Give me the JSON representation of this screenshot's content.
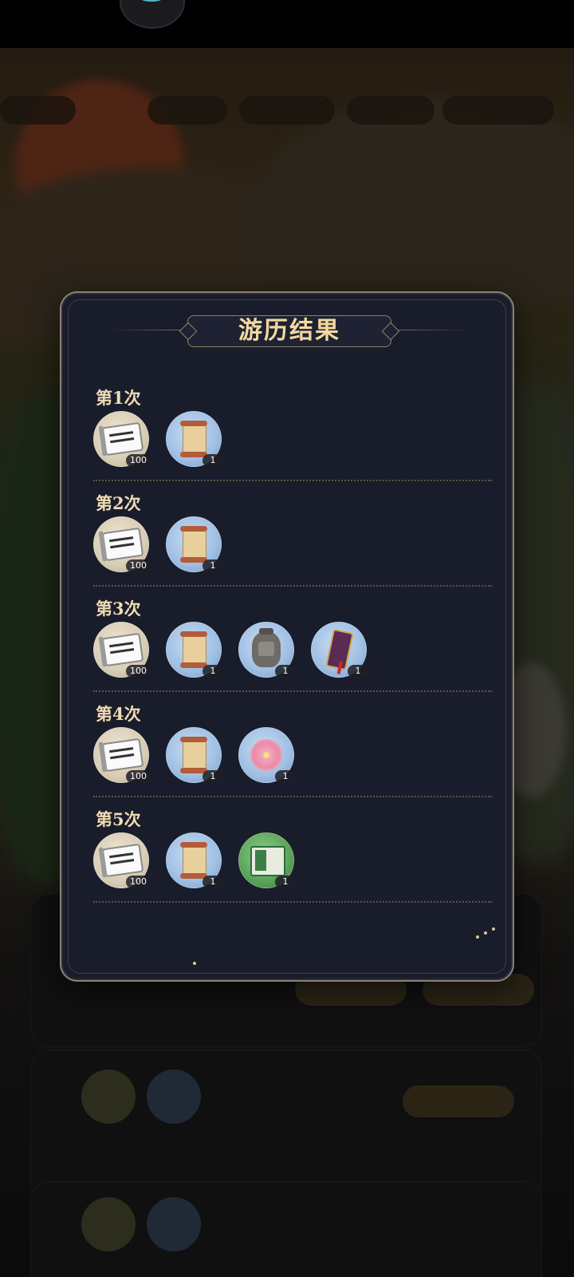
{
  "modal": {
    "title": "游历结果",
    "rounds": [
      {
        "label": "第1次",
        "items": [
          {
            "icon": "silk-banner-icon",
            "count": "100"
          },
          {
            "icon": "scroll-icon",
            "count": "1"
          }
        ]
      },
      {
        "label": "第2次",
        "items": [
          {
            "icon": "silk-banner-icon",
            "count": "100"
          },
          {
            "icon": "scroll-icon",
            "count": "1"
          }
        ]
      },
      {
        "label": "第3次",
        "items": [
          {
            "icon": "silk-banner-icon",
            "count": "100"
          },
          {
            "icon": "scroll-icon",
            "count": "1"
          },
          {
            "icon": "wine-jar-icon",
            "count": "1"
          },
          {
            "icon": "token-tablet-icon",
            "count": "1"
          }
        ]
      },
      {
        "label": "第4次",
        "items": [
          {
            "icon": "silk-banner-icon",
            "count": "100"
          },
          {
            "icon": "scroll-icon",
            "count": "1"
          },
          {
            "icon": "peony-flower-icon",
            "count": "1"
          }
        ]
      },
      {
        "label": "第5次",
        "items": [
          {
            "icon": "silk-banner-icon",
            "count": "100"
          },
          {
            "icon": "scroll-icon",
            "count": "1"
          },
          {
            "icon": "green-book-icon",
            "count": "1"
          }
        ]
      }
    ]
  },
  "colors": {
    "title_text": "#f3d9a0",
    "modal_bg": "#191c2b",
    "modal_border": "#8b8272"
  }
}
